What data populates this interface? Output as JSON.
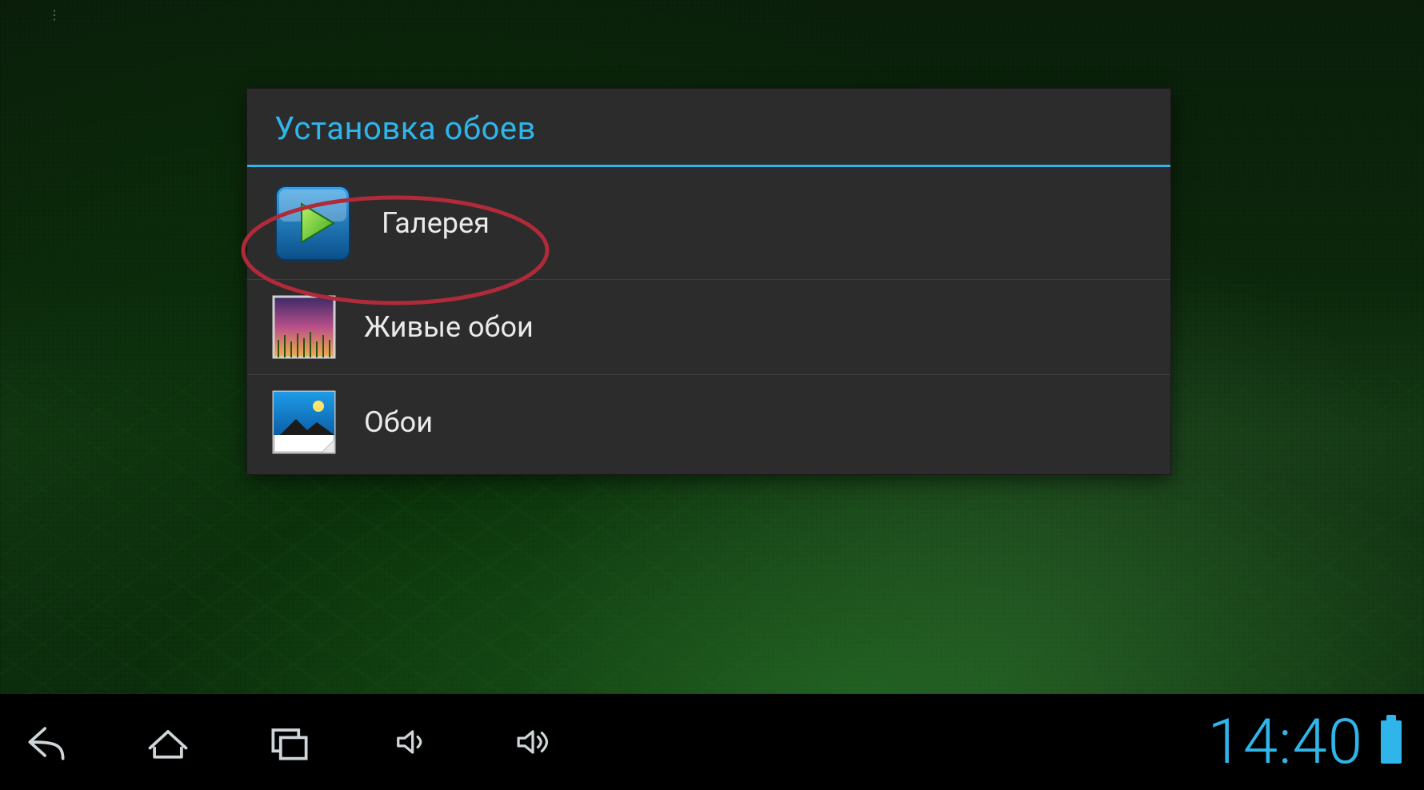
{
  "dialog": {
    "title": "Установка обоев",
    "options": [
      {
        "label": "Галерея",
        "name": "option-gallery"
      },
      {
        "label": "Живые обои",
        "name": "option-live-wallpaper"
      },
      {
        "label": "Обои",
        "name": "option-wallpapers"
      }
    ]
  },
  "annotation": {
    "highlighted_option_index": 0,
    "shape": "ellipse",
    "stroke": "#b02a3a"
  },
  "navbar": {
    "back": "Назад",
    "home": "Домой",
    "recents": "Недавние",
    "volume_down": "Тише",
    "volume_up": "Громче",
    "clock": "14:40"
  },
  "colors": {
    "accent": "#2fb5e9",
    "dialog_bg": "#2c2c2c",
    "text": "#eaeaea"
  }
}
